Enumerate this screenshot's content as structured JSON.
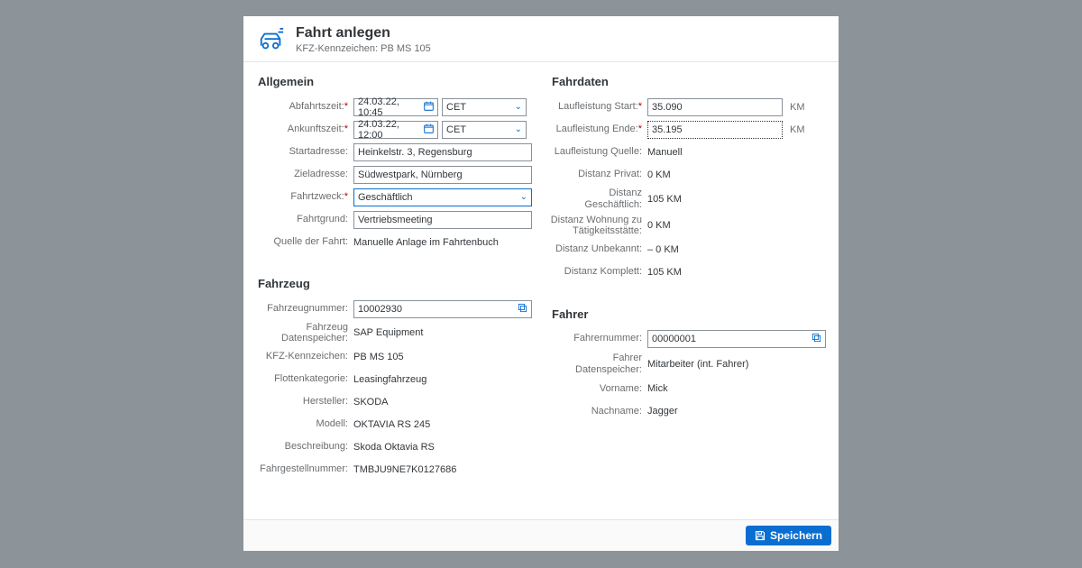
{
  "header": {
    "title": "Fahrt anlegen",
    "subtitle": "KFZ-Kennzeichen: PB MS 105"
  },
  "allgemein": {
    "title": "Allgemein",
    "abfahrtszeit_label": "Abfahrtszeit:",
    "abfahrtszeit_value": "24.03.22, 10:45",
    "abfahrtszeit_tz": "CET",
    "ankunftszeit_label": "Ankunftszeit:",
    "ankunftszeit_value": "24.03.22, 12:00",
    "ankunftszeit_tz": "CET",
    "startadresse_label": "Startadresse:",
    "startadresse_value": "Heinkelstr. 3, Regensburg",
    "zieladresse_label": "Zieladresse:",
    "zieladresse_value": "Südwestpark, Nürnberg",
    "fahrtzweck_label": "Fahrtzweck:",
    "fahrtzweck_value": "Geschäftlich",
    "fahrtgrund_label": "Fahrtgrund:",
    "fahrtgrund_value": "Vertriebsmeeting",
    "quelle_label": "Quelle der Fahrt:",
    "quelle_value": "Manuelle Anlage im Fahrtenbuch"
  },
  "fahrdaten": {
    "title": "Fahrdaten",
    "laufleistung_start_label": "Laufleistung Start:",
    "laufleistung_start_value": "35.090",
    "laufleistung_ende_label": "Laufleistung Ende:",
    "laufleistung_ende_value": "35.195",
    "laufleistung_quelle_label": "Laufleistung Quelle:",
    "laufleistung_quelle_value": "Manuell",
    "distanz_privat_label": "Distanz Privat:",
    "distanz_privat_value": "0 KM",
    "distanz_geschaeftlich_label": "Distanz Geschäftlich:",
    "distanz_geschaeftlich_value": "105 KM",
    "distanz_wohnung_label": "Distanz Wohnung zu Tätigkeitsstätte:",
    "distanz_wohnung_value": "0 KM",
    "distanz_unbekannt_label": "Distanz Unbekannt:",
    "distanz_unbekannt_value": "– 0 KM",
    "distanz_komplett_label": "Distanz Komplett:",
    "distanz_komplett_value": "105 KM",
    "unit": "KM"
  },
  "fahrzeug": {
    "title": "Fahrzeug",
    "fahrzeugnummer_label": "Fahrzeugnummer:",
    "fahrzeugnummer_value": "10002930",
    "datenspeicher_label": "Fahrzeug Datenspeicher:",
    "datenspeicher_value": "SAP Equipment",
    "kennzeichen_label": "KFZ-Kennzeichen:",
    "kennzeichen_value": "PB MS 105",
    "flottenkategorie_label": "Flottenkategorie:",
    "flottenkategorie_value": "Leasingfahrzeug",
    "hersteller_label": "Hersteller:",
    "hersteller_value": "SKODA",
    "modell_label": "Modell:",
    "modell_value": "OKTAVIA RS 245",
    "beschreibung_label": "Beschreibung:",
    "beschreibung_value": "Skoda Oktavia RS",
    "fahrgestell_label": "Fahrgestellnummer:",
    "fahrgestell_value": "TMBJU9NE7K0127686"
  },
  "fahrer": {
    "title": "Fahrer",
    "fahrernummer_label": "Fahrernummer:",
    "fahrernummer_value": "00000001",
    "datenspeicher_label": "Fahrer Datenspeicher:",
    "datenspeicher_value": "Mitarbeiter (int. Fahrer)",
    "vorname_label": "Vorname:",
    "vorname_value": "Mick",
    "nachname_label": "Nachname:",
    "nachname_value": "Jagger"
  },
  "footer": {
    "save_label": "Speichern"
  }
}
